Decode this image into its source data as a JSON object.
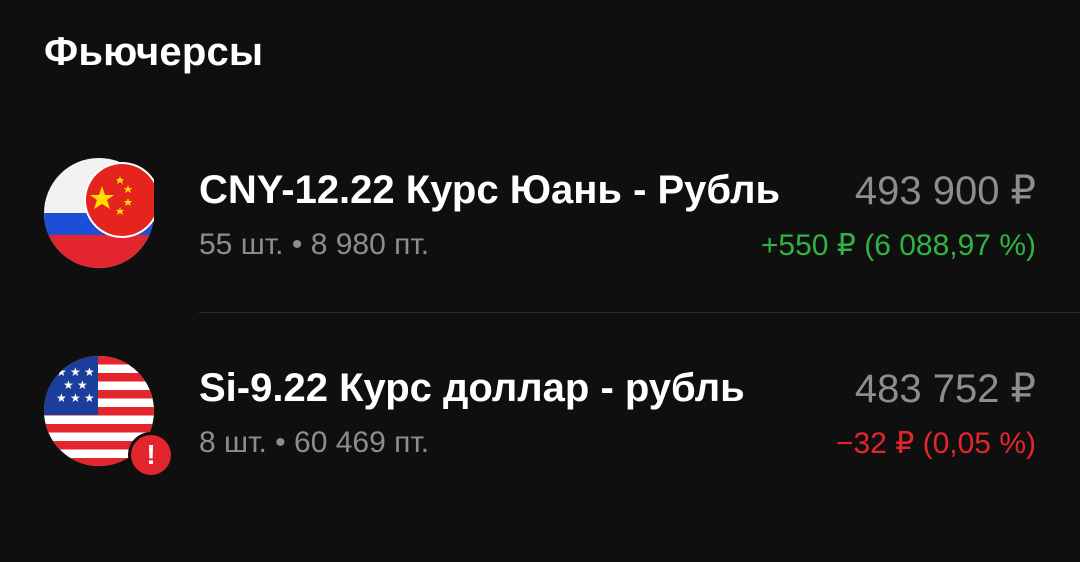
{
  "section": {
    "title": "Фьючерсы"
  },
  "colors": {
    "positive": "#2fb344",
    "negative": "#e3262e",
    "secondary_text": "#8c8d91"
  },
  "futures": [
    {
      "icon": "cny-rub-flag-icon",
      "name": "CNY-12.22 Курс Юань - Рубль",
      "subtitle": "55 шт. • 8 980 пт.",
      "price": "493 900 ₽",
      "change": "+550 ₽ (6 088,97 %)",
      "change_direction": "positive"
    },
    {
      "icon": "usd-flag-icon",
      "name": "Si-9.22 Курс доллар - рубль",
      "subtitle": "8 шт. • 60 469 пт.",
      "price": "483 752 ₽",
      "change": "−32 ₽ (0,05 %)",
      "change_direction": "negative",
      "warning_badge": "!"
    }
  ]
}
